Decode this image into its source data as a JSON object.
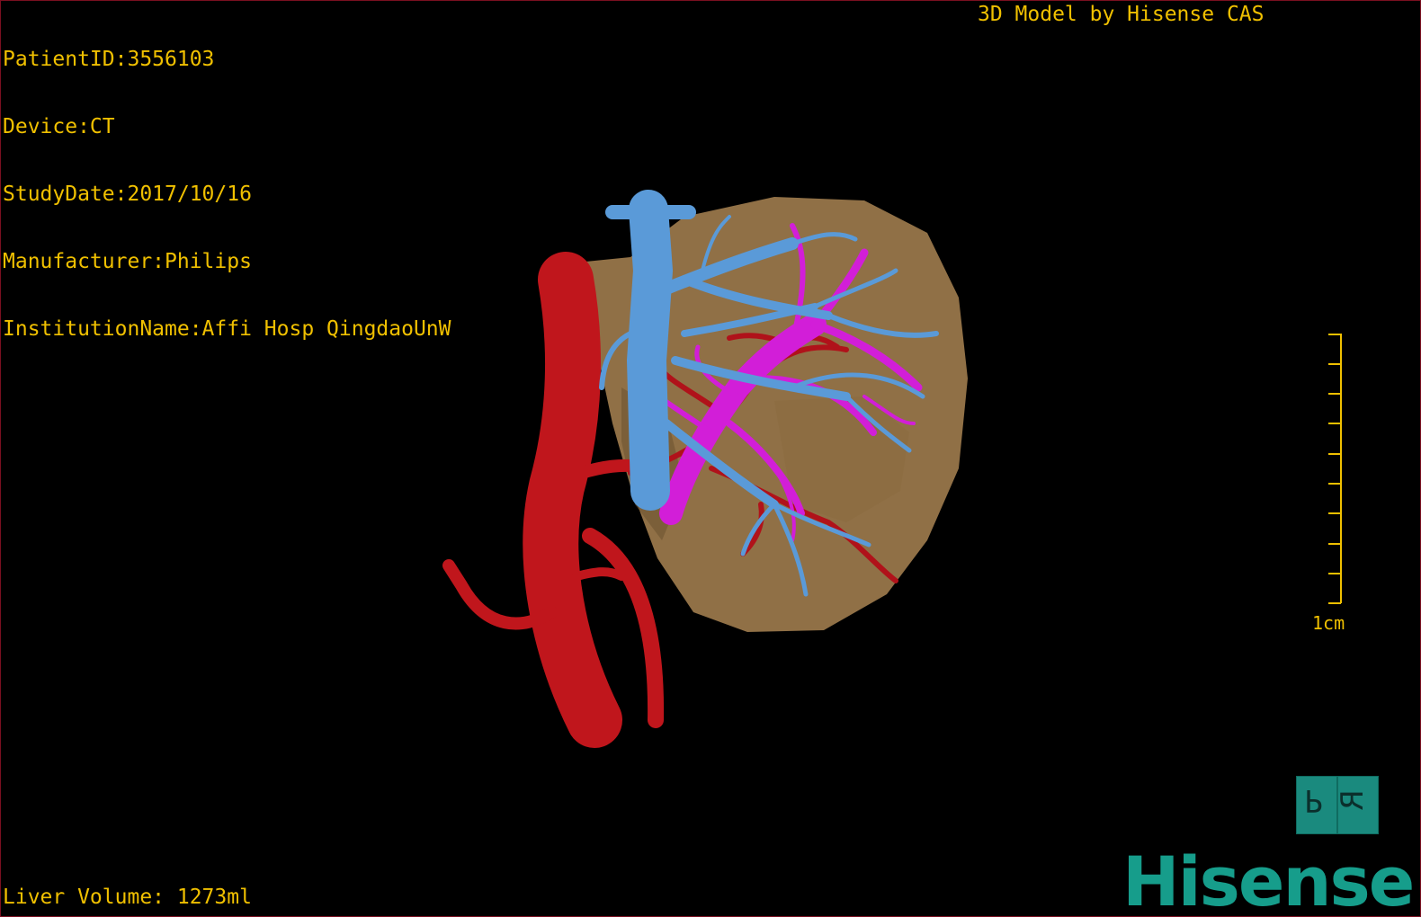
{
  "dicom": {
    "patient_id": "PatientID:3556103",
    "device": "Device:CT",
    "study_date": "StudyDate:2017/10/16",
    "manufacturer": "Manufacturer:Philips",
    "institution": "InstitutionName:Affi Hosp QingdaoUnW"
  },
  "caption": "3D Model by Hisense CAS",
  "footer": {
    "liver_volume": "Liver Volume: 1273ml"
  },
  "scale": {
    "label": "1cm"
  },
  "orientation": {
    "left_face": "P",
    "right_face": "R"
  },
  "brand": {
    "logo": "Hisense"
  },
  "colors": {
    "overlay_text": "#f0c000",
    "liver": "#9c7a4c",
    "artery": "#c0161c",
    "portal_vein": "#d21ed8",
    "hepatic_vein": "#5a9ad8",
    "brand": "#169d8b"
  }
}
